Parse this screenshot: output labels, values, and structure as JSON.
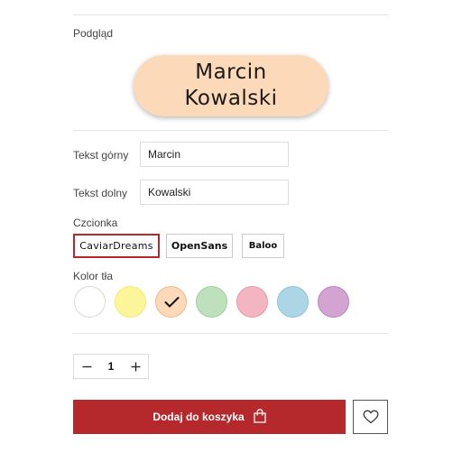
{
  "preview": {
    "label": "Podgląd",
    "top_text": "Marcin",
    "bottom_text": "Kowalski",
    "badge_color": "#fcd9b8"
  },
  "fields": {
    "top_label": "Tekst górny",
    "top_value": "Marcin",
    "bottom_label": "Tekst dolny",
    "bottom_value": "Kowalski"
  },
  "fonts": {
    "label": "Czcionka",
    "options": [
      {
        "name": "CaviarDreams",
        "selected": true
      },
      {
        "name": "OpenSans",
        "selected": false
      },
      {
        "name": "Baloo",
        "selected": false
      }
    ]
  },
  "background": {
    "label": "Kolor tła",
    "selected_index": 2,
    "swatches": [
      {
        "fill": "#ffffff",
        "border": "#d9d9d9"
      },
      {
        "fill": "#fdf59a",
        "border": "#f4e879"
      },
      {
        "fill": "#fcd9b8",
        "border": "#f0b890"
      },
      {
        "fill": "#bfe0bd",
        "border": "#9fcf9b"
      },
      {
        "fill": "#f4b5c2",
        "border": "#ec96a8"
      },
      {
        "fill": "#acd5e6",
        "border": "#8dc4da"
      },
      {
        "fill": "#d3a4d1",
        "border": "#bc82ba"
      }
    ]
  },
  "quantity": {
    "value": "1",
    "minus_icon": "minus-icon",
    "plus_icon": "plus-icon"
  },
  "cart": {
    "add_label": "Dodaj do koszyka",
    "bag_icon": "shopping-bag-icon",
    "wishlist_icon": "heart-icon"
  },
  "colors": {
    "accent": "#b5292c"
  }
}
